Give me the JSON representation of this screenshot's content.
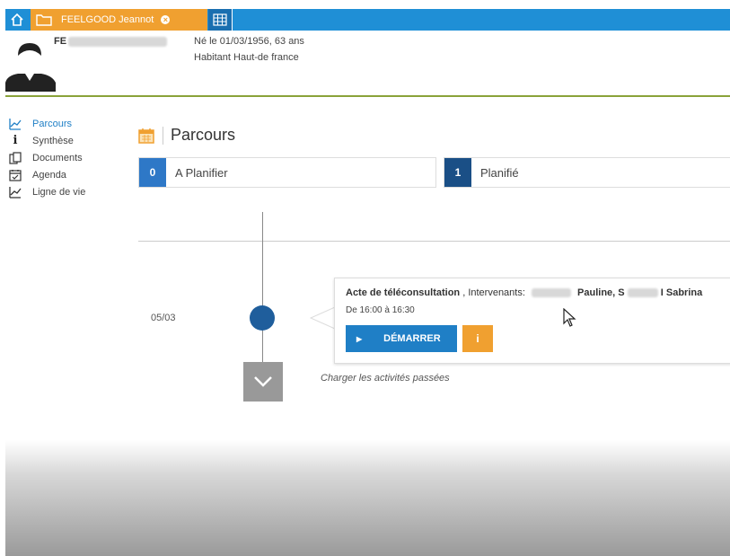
{
  "topbar": {
    "patient_tab_label": "FEELGOOD Jeannot",
    "icons": [
      "home-icon",
      "folder-icon",
      "close-icon",
      "calendar-grid-icon"
    ]
  },
  "header": {
    "patient_name_prefix": "FE",
    "birth_info": "Né le 01/03/1956, 63 ans",
    "residence": "Habitant Haut-de france"
  },
  "sidebar": {
    "items": [
      {
        "label": "Parcours",
        "icon": "chart-line-icon",
        "active": true
      },
      {
        "label": "Synthèse",
        "icon": "info-icon",
        "active": false
      },
      {
        "label": "Documents",
        "icon": "documents-icon",
        "active": false
      },
      {
        "label": "Agenda",
        "icon": "calendar-check-icon",
        "active": false
      },
      {
        "label": "Ligne de vie",
        "icon": "chart-line-icon",
        "active": false
      }
    ]
  },
  "main": {
    "title": "Parcours",
    "statuses": [
      {
        "count": "0",
        "label": "A Planifier"
      },
      {
        "count": "1",
        "label": "Planifié"
      }
    ],
    "timeline": {
      "date": "05/03",
      "load_past": "Charger les activités passées"
    },
    "activity": {
      "title": "Acte de téléconsultation",
      "intervenants_label": ", Intervenants:",
      "person1": "Pauline, S",
      "person2": "I Sabrina",
      "time": "De 16:00 à 16:30",
      "start_label": "DÉMARRER",
      "info_label": "i"
    }
  },
  "colors": {
    "topbar": "#1f8fd6",
    "accent_orange": "#f0a030",
    "accent_blue": "#1f7fc6",
    "dark_blue": "#1a4f86",
    "header_border": "#8aa33a"
  }
}
